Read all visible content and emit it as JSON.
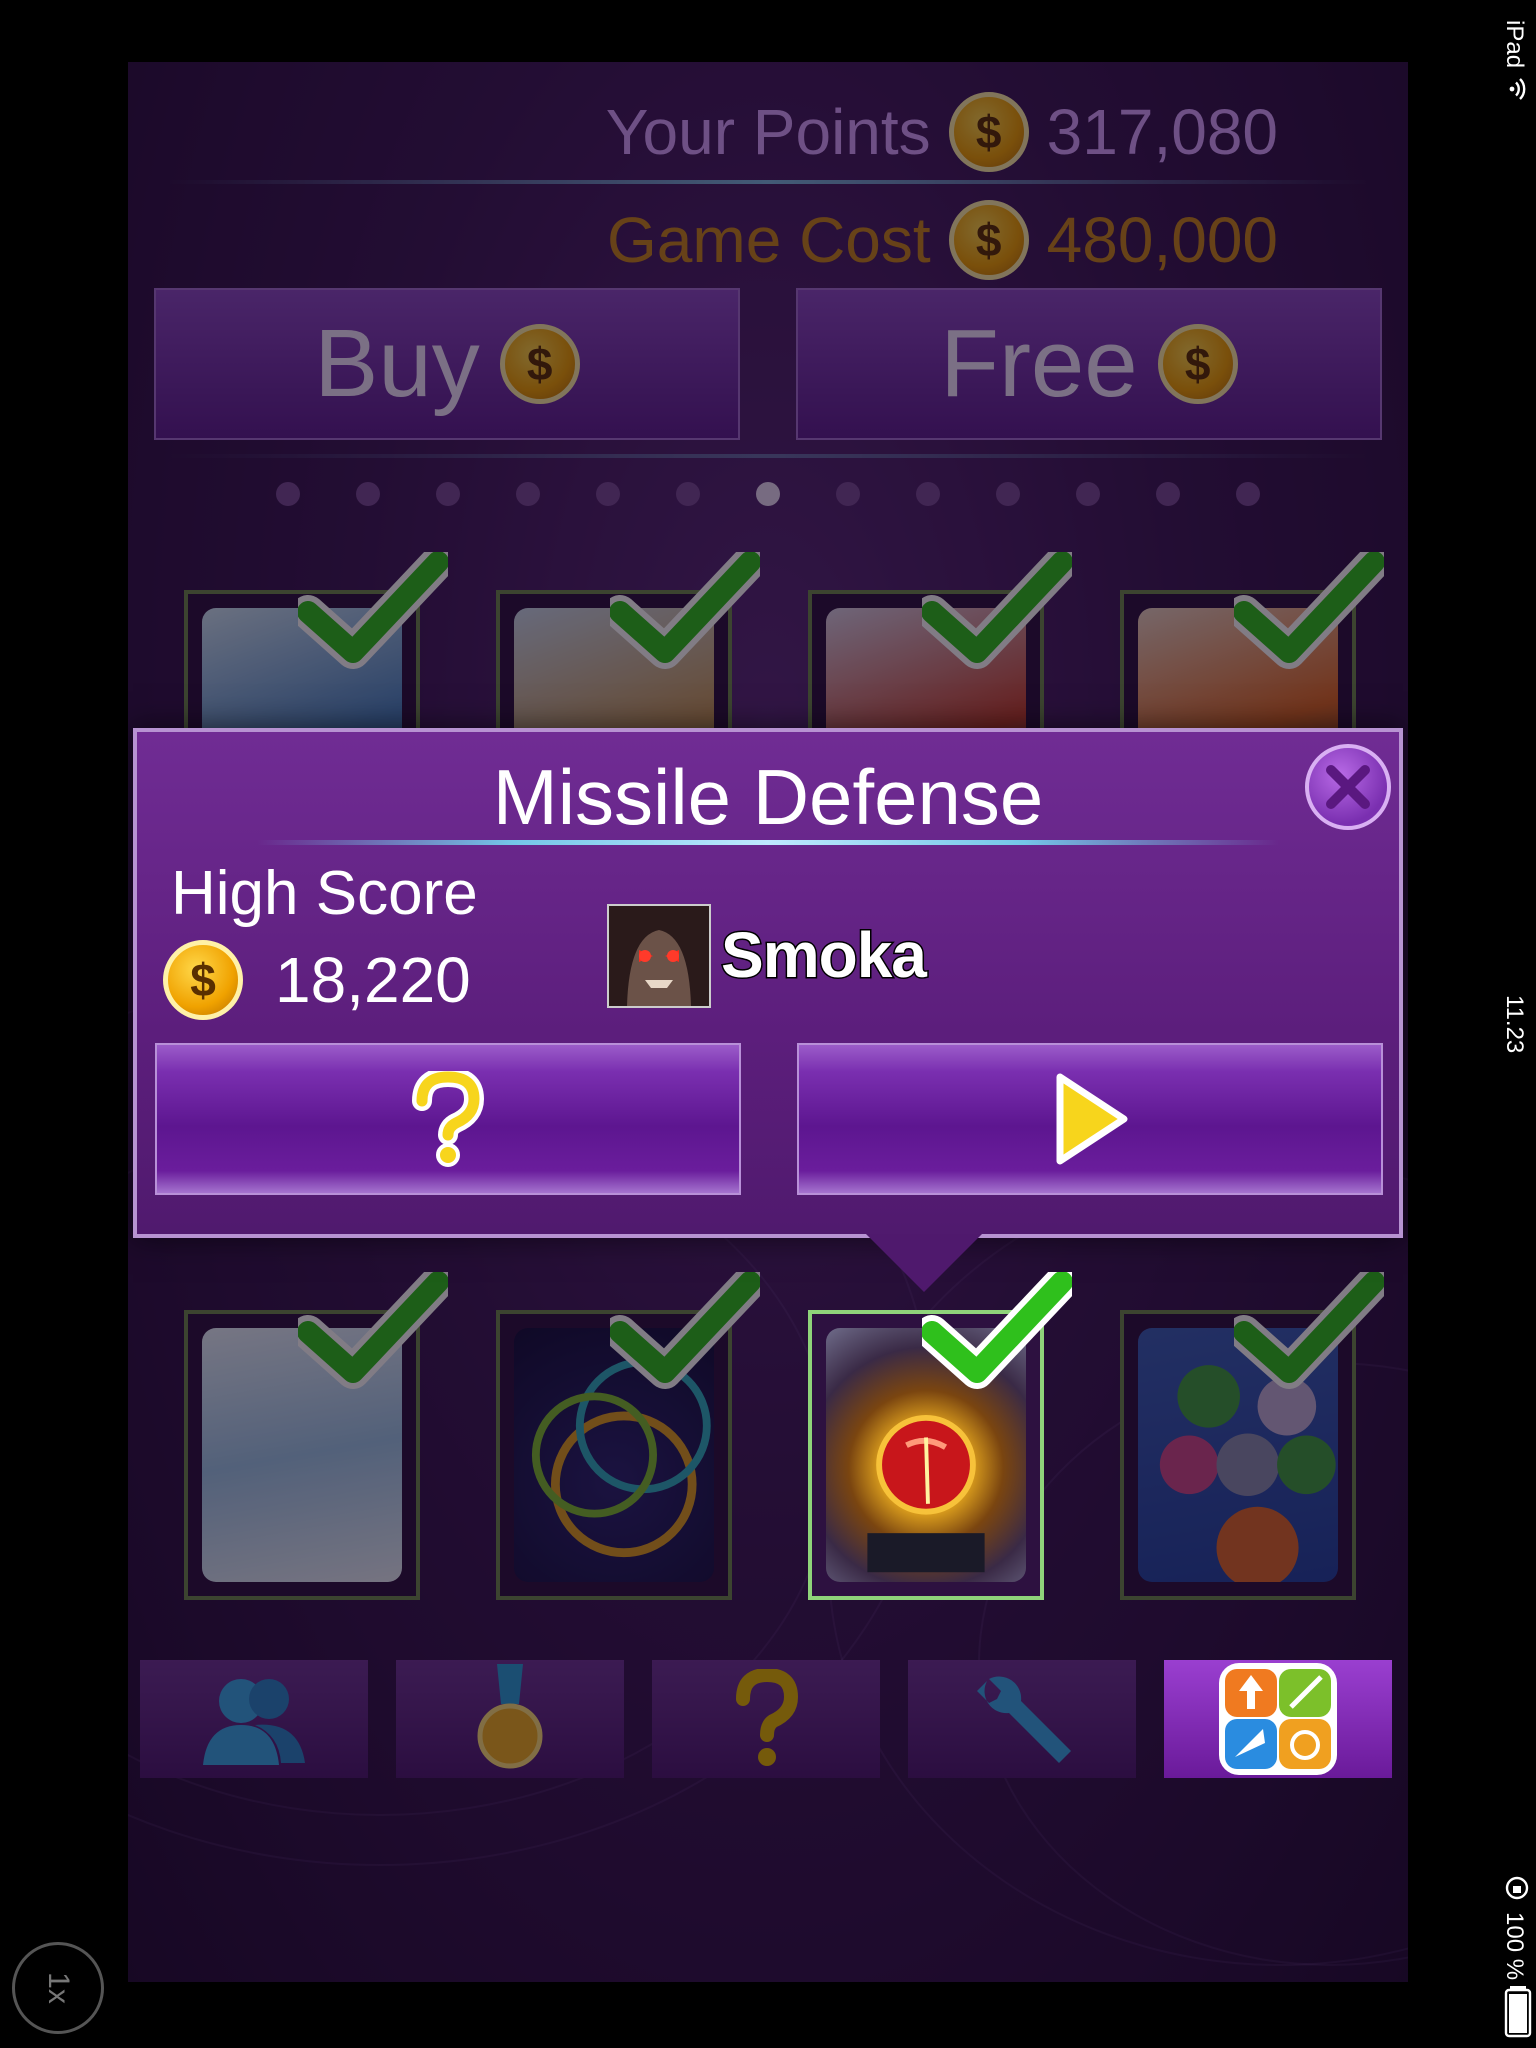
{
  "status_bar": {
    "device": "iPad",
    "time": "11.23",
    "battery": "100 %"
  },
  "zoom_button": {
    "label": "1x"
  },
  "header": {
    "points_label": "Your Points",
    "points_value": "317,080",
    "cost_label": "Game Cost",
    "cost_value": "480,000"
  },
  "top_buttons": {
    "buy_label": "Buy",
    "free_label": "Free"
  },
  "coin_symbol": "$",
  "pager": {
    "count": 13,
    "active_index": 6
  },
  "games_row1": [
    {
      "name": "game-tile-1",
      "checked": true
    },
    {
      "name": "game-tile-2",
      "checked": true
    },
    {
      "name": "game-tile-3",
      "checked": true
    },
    {
      "name": "game-tile-4",
      "checked": true
    }
  ],
  "games_row2": [
    {
      "name": "penguin-game-tile",
      "checked": true
    },
    {
      "name": "rings-game-tile",
      "checked": true
    },
    {
      "name": "missile-defense-tile",
      "checked": true,
      "selected": true
    },
    {
      "name": "bubble-game-tile",
      "checked": true
    }
  ],
  "popup": {
    "title": "Missile Defense",
    "high_score_label": "High Score",
    "high_score_value": "18,220",
    "player_name": "Smoka"
  },
  "toolbar": {
    "items": [
      "friends-icon",
      "medal-icon",
      "help-icon",
      "settings-wrench-icon",
      "game-center-icon"
    ],
    "active_index": 4
  },
  "colors": {
    "popup_bg": "#5c1e7c",
    "check_green": "#2fc01c",
    "coin_gold": "#f0a200",
    "play_yellow": "#f7d51c"
  }
}
